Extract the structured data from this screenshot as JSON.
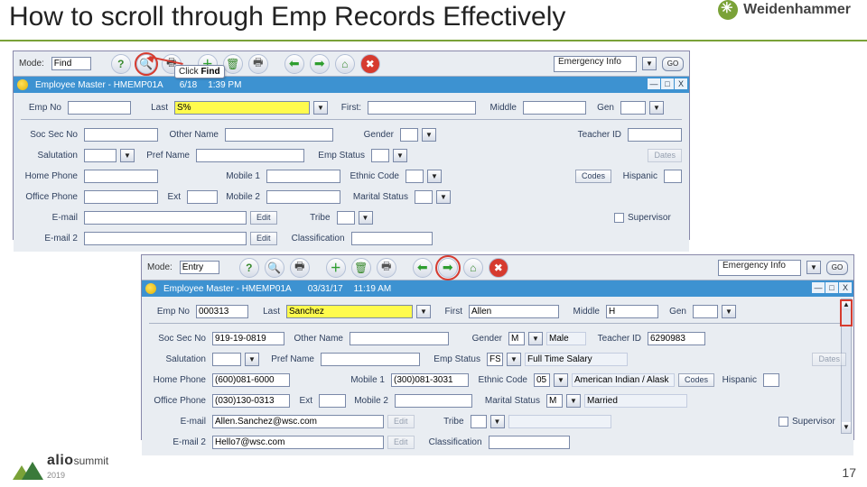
{
  "slide": {
    "title": "How to scroll through Emp Records Effectively",
    "page": "17"
  },
  "brand": {
    "name": "Weidenhammer"
  },
  "footer": {
    "product": "alio",
    "event": "summit",
    "year": "2019"
  },
  "top": {
    "mode_label": "Mode:",
    "mode_value": "Find",
    "dropdown_label": "Emergency Info",
    "go": "GO",
    "callout_prefix": "Click ",
    "callout_action": "Find",
    "win": {
      "title": "Employee Master - HMEMP01A",
      "date": "6/18",
      "time": "1:39 PM",
      "min": "—",
      "max": "□",
      "x": "X"
    },
    "labels": {
      "emp_no": "Emp No",
      "last": "Last",
      "first": "First:",
      "middle": "Middle",
      "gen": "Gen",
      "soc": "Soc Sec No",
      "other": "Other Name",
      "gender": "Gender",
      "teacher": "Teacher ID",
      "sal": "Salutation",
      "pref": "Pref Name",
      "empstat": "Emp Status",
      "home": "Home Phone",
      "m1": "Mobile 1",
      "ethnic": "Ethnic Code",
      "office": "Office Phone",
      "ext": "Ext",
      "m2": "Mobile 2",
      "marital": "Marital Status",
      "email": "E-mail",
      "tribe": "Tribe",
      "email2": "E-mail 2",
      "class": "Classification",
      "dates": "Dates",
      "codes": "Codes",
      "hispanic": "Hispanic",
      "supervisor": "Supervisor",
      "edit": "Edit"
    },
    "values": {
      "last": "S%"
    }
  },
  "bottom": {
    "mode_label": "Mode:",
    "mode_value": "Entry",
    "dropdown_label": "Emergency Info",
    "go": "GO",
    "win": {
      "title": "Employee Master - HMEMP01A",
      "date": "03/31/17",
      "time": "11:19 AM",
      "min": "—",
      "max": "□",
      "x": "X"
    },
    "labels": {
      "emp_no": "Emp No",
      "last": "Last",
      "first": "First",
      "middle": "Middle",
      "gen": "Gen",
      "soc": "Soc Sec No",
      "other": "Other Name",
      "gender": "Gender",
      "teacher": "Teacher ID",
      "sal": "Salutation",
      "pref": "Pref Name",
      "empstat": "Emp Status",
      "home": "Home Phone",
      "m1": "Mobile 1",
      "ethnic": "Ethnic Code",
      "office": "Office Phone",
      "ext": "Ext",
      "m2": "Mobile 2",
      "marital": "Marital Status",
      "email": "E-mail",
      "tribe": "Tribe",
      "email2": "E-mail 2",
      "class": "Classification",
      "dates": "Dates",
      "codes": "Codes",
      "hispanic": "Hispanic",
      "supervisor": "Supervisor",
      "edit": "Edit"
    },
    "values": {
      "emp_no": "000313",
      "last": "Sanchez",
      "first": "Allen",
      "middle": "H",
      "soc": "919-19-0819",
      "gender": "M",
      "gender_desc": "Male",
      "teacher": "6290983",
      "empstat": "FS",
      "empstat_desc": "Full Time Salary",
      "home": "(600)081-6000",
      "m1": "(300)081-3031",
      "ethnic": "05",
      "ethnic_desc": "American Indian / Alask",
      "office": "(030)130-0313",
      "marital": "M",
      "marital_desc": "Married",
      "email": "Allen.Sanchez@wsc.com",
      "email2": "Hello7@wsc.com"
    }
  }
}
